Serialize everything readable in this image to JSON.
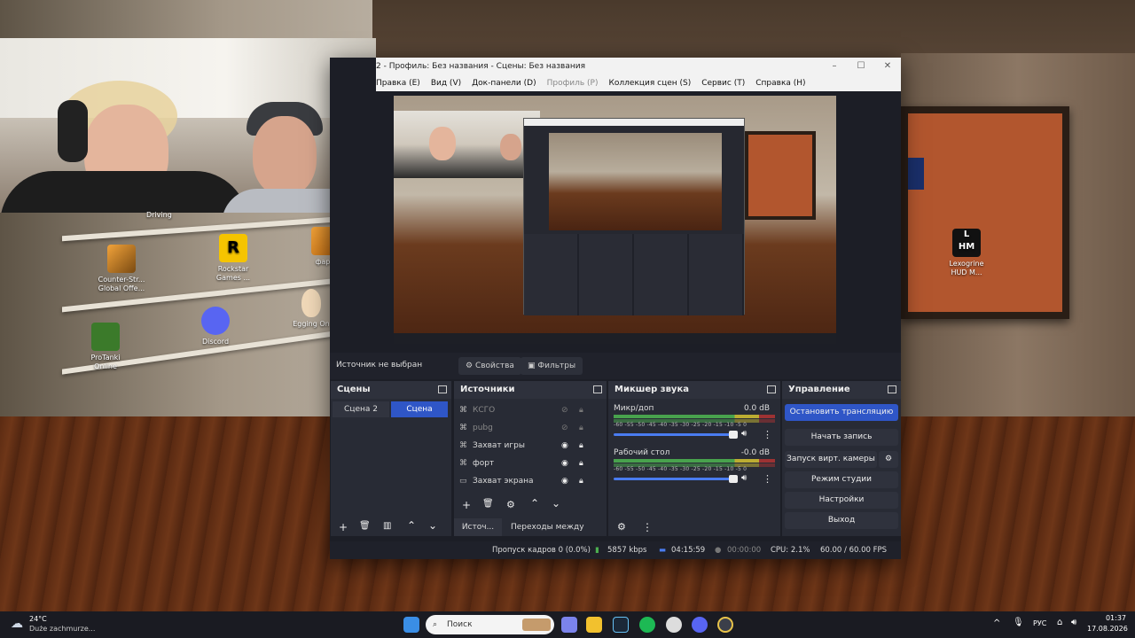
{
  "desktop": {
    "icons": [
      {
        "label": "Counter-Str...\nGlobal Offe...",
        "icon": "csgo-icon"
      },
      {
        "label": "Rockstar\nGames ...",
        "icon": "rockstar-icon"
      },
      {
        "label": "фарм",
        "icon": "cs-icon"
      },
      {
        "label": "Discord",
        "icon": "discord-icon"
      },
      {
        "label": "Egging On",
        "icon": "egg-icon"
      },
      {
        "label": "ProTanki\nOnline",
        "icon": "tank-icon"
      },
      {
        "label": "Lexogrine\nHUD M...",
        "icon": "lhm-icon"
      }
    ],
    "cut_labels": [
      "Driving"
    ]
  },
  "obs": {
    "title": "2 - Профиль: Без названия - Сцены: Без названия",
    "menu": [
      "Правка (E)",
      "Вид (V)",
      "Док-панели (D)",
      "Профиль (P)",
      "Коллекция сцен (S)",
      "Сервис (T)",
      "Справка (H)"
    ],
    "menu_disabled_index": 3,
    "source_bar": {
      "label": "Источник не выбран",
      "properties": "Свойства",
      "filters": "Фильтры"
    },
    "scenes": {
      "title": "Сцены",
      "items": [
        "Сцена 2",
        "Сцена"
      ],
      "selected": "Сцена"
    },
    "sources": {
      "title": "Источники",
      "items": [
        {
          "name": "КСГО",
          "hidden": true
        },
        {
          "name": "pubg",
          "hidden": true
        },
        {
          "name": "Захват игры",
          "hidden": false
        },
        {
          "name": "форт",
          "hidden": false
        },
        {
          "name": "Захват экрана",
          "hidden": false
        }
      ],
      "tabs": [
        "Источ...",
        "Переходы между сце..."
      ]
    },
    "mixer": {
      "title": "Микшер звука",
      "scale": "-60 -55 -50 -45 -40 -35 -30 -25 -20 -15 -10 -5 0",
      "channels": [
        {
          "name": "Микр/доп",
          "level": "0.0 dB"
        },
        {
          "name": "Рабочий стол",
          "level": "-0.0 dB"
        }
      ]
    },
    "controls": {
      "title": "Управление",
      "buttons": [
        "Остановить трансляцию",
        "Начать запись",
        "Запуск вирт. камеры",
        "Режим студии",
        "Настройки",
        "Выход"
      ]
    },
    "status": {
      "dropped": "Пропуск кадров 0 (0.0%)",
      "bitrate": "5857 kbps",
      "stream_time": "04:15:59",
      "rec_time": "00:00:00",
      "cpu": "CPU: 2.1%",
      "fps": "60.00 / 60.00 FPS"
    }
  },
  "taskbar": {
    "weather_temp": "24°C",
    "weather_desc": "Duże zachmurze...",
    "search_placeholder": "Поиск",
    "lang": "РУС",
    "time": "01:37",
    "date": "17.08.2026"
  },
  "colors": {
    "accent": "#2f56c7",
    "obs_bg": "#282b35"
  }
}
